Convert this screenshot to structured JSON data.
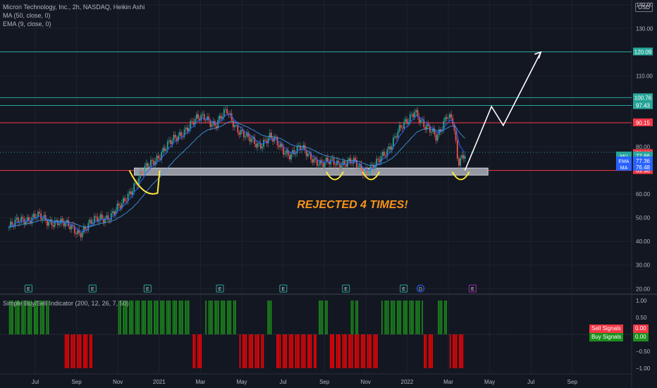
{
  "header": {
    "title": "Micron Technology, Inc., 2h, NASDAQ, Heikin Ashi",
    "ma_legend": "MA (50, close, 0)",
    "ema_legend": "EMA (9, close, 0)",
    "currency": "USD"
  },
  "indicator": {
    "legend": "Simple Buy/Sell Indicator (200, 12, 26, 7, 50)",
    "sell_label": "Sell Signals",
    "sell_value": "0.00",
    "buy_label": "Buy Signals",
    "buy_value": "0.00",
    "y_ticks": [
      "1.00",
      "0.50",
      "0.00",
      "−0.50",
      "−1.00"
    ]
  },
  "annotation": {
    "text": "REJECTED 4 TIMES!"
  },
  "colors": {
    "background": "#131722",
    "up_candle": "#26a69a",
    "down_candle": "#ef5350",
    "resistance_green": "#26a69a",
    "resistance_red": "#f23645",
    "annotation_orange": "#f7931a",
    "circle_yellow": "#ffeb3b",
    "ema_blue": "#2962ff",
    "buy_green": "#1b8f1b",
    "sell_red": "#ff0000"
  },
  "chart_data": {
    "type": "candlestick",
    "symbol": "MU",
    "x_ticks": [
      "Jul",
      "Sep",
      "Nov",
      "2021",
      "Mar",
      "May",
      "Jul",
      "Sep",
      "Nov",
      "2022",
      "Mar",
      "May",
      "Jul",
      "Sep"
    ],
    "y_ticks": [
      20.0,
      30.0,
      40.0,
      50.0,
      60.0,
      70.0,
      80.0,
      90.0,
      100.0,
      110.0,
      120.0,
      130.0,
      140.0
    ],
    "ylim": [
      18,
      142
    ],
    "horizontal_levels": [
      {
        "value": 120.09,
        "label": "120.09",
        "color": "#26a69a"
      },
      {
        "value": 100.76,
        "label": "100.76",
        "color": "#26a69a"
      },
      {
        "value": 97.43,
        "label": "97.43",
        "color": "#26a69a"
      },
      {
        "value": 90.15,
        "label": "90.15",
        "color": "#f23645"
      },
      {
        "value": 69.98,
        "label": "69.98",
        "color": "#f23645"
      }
    ],
    "price_labels": [
      {
        "name": "78.09",
        "value": 78.09,
        "tag": "",
        "color": "#f23645"
      },
      {
        "name": "MU",
        "value": 77.66,
        "tag": "MU",
        "color": "#26a69a"
      },
      {
        "name": "EMA",
        "value": 77.36,
        "tag": "EMA",
        "color": "#2962ff"
      },
      {
        "name": "MA",
        "value": 76.48,
        "tag": "MA",
        "color": "#2962ff"
      }
    ],
    "support_zone": [
      68.0,
      71.0
    ],
    "projection_path": [
      {
        "x": "2022-03-18",
        "y": 70
      },
      {
        "x": "2022-04-25",
        "y": 97
      },
      {
        "x": "2022-05-12",
        "y": 89
      },
      {
        "x": "2022-07-05",
        "y": 120
      }
    ],
    "close_series": [
      {
        "x": "2020-06-01",
        "y": 46
      },
      {
        "x": "2020-06-20",
        "y": 49
      },
      {
        "x": "2020-07-10",
        "y": 51
      },
      {
        "x": "2020-07-25",
        "y": 48
      },
      {
        "x": "2020-08-10",
        "y": 49
      },
      {
        "x": "2020-08-25",
        "y": 46
      },
      {
        "x": "2020-09-10",
        "y": 44
      },
      {
        "x": "2020-09-25",
        "y": 47
      },
      {
        "x": "2020-10-10",
        "y": 50
      },
      {
        "x": "2020-10-25",
        "y": 51
      },
      {
        "x": "2020-11-10",
        "y": 55
      },
      {
        "x": "2020-11-25",
        "y": 63
      },
      {
        "x": "2020-12-10",
        "y": 69
      },
      {
        "x": "2020-12-25",
        "y": 74
      },
      {
        "x": "2021-01-10",
        "y": 79
      },
      {
        "x": "2021-01-25",
        "y": 83
      },
      {
        "x": "2021-02-10",
        "y": 88
      },
      {
        "x": "2021-02-25",
        "y": 91
      },
      {
        "x": "2021-03-10",
        "y": 93
      },
      {
        "x": "2021-03-25",
        "y": 89
      },
      {
        "x": "2021-04-10",
        "y": 95
      },
      {
        "x": "2021-04-25",
        "y": 88
      },
      {
        "x": "2021-05-10",
        "y": 83
      },
      {
        "x": "2021-05-25",
        "y": 81
      },
      {
        "x": "2021-06-10",
        "y": 84
      },
      {
        "x": "2021-06-25",
        "y": 80
      },
      {
        "x": "2021-07-10",
        "y": 77
      },
      {
        "x": "2021-07-25",
        "y": 79
      },
      {
        "x": "2021-08-10",
        "y": 76
      },
      {
        "x": "2021-08-25",
        "y": 72
      },
      {
        "x": "2021-09-10",
        "y": 74
      },
      {
        "x": "2021-09-25",
        "y": 73
      },
      {
        "x": "2021-10-10",
        "y": 73
      },
      {
        "x": "2021-10-25",
        "y": 70
      },
      {
        "x": "2021-11-10",
        "y": 72
      },
      {
        "x": "2021-11-25",
        "y": 78
      },
      {
        "x": "2021-12-10",
        "y": 86
      },
      {
        "x": "2021-12-25",
        "y": 90
      },
      {
        "x": "2022-01-05",
        "y": 96
      },
      {
        "x": "2022-01-20",
        "y": 88
      },
      {
        "x": "2022-02-05",
        "y": 84
      },
      {
        "x": "2022-02-20",
        "y": 94
      },
      {
        "x": "2022-03-01",
        "y": 90
      },
      {
        "x": "2022-03-08",
        "y": 72
      },
      {
        "x": "2022-03-18",
        "y": 77.66
      }
    ],
    "earnings_markers": [
      {
        "x": "2020-06-29",
        "label": "E"
      },
      {
        "x": "2020-09-29",
        "label": "E"
      },
      {
        "x": "2020-12-17",
        "label": "E"
      },
      {
        "x": "2021-03-31",
        "label": "E"
      },
      {
        "x": "2021-06-30",
        "label": "E"
      },
      {
        "x": "2021-09-28",
        "label": "E"
      },
      {
        "x": "2021-12-20",
        "label": "E"
      },
      {
        "x": "2022-03-29",
        "label": "E"
      }
    ],
    "dividend_markers": [
      {
        "x": "2022-01-03",
        "label": "D"
      }
    ],
    "indicator_signals": {
      "buy_ranges": [
        [
          "2020-06-01",
          "2020-07-28"
        ],
        [
          "2020-11-05",
          "2021-02-15"
        ],
        [
          "2021-03-10",
          "2021-04-22"
        ],
        [
          "2021-06-05",
          "2021-06-12"
        ],
        [
          "2021-08-20",
          "2021-09-01"
        ],
        [
          "2021-10-05",
          "2021-10-15"
        ],
        [
          "2021-11-18",
          "2022-01-15"
        ],
        [
          "2022-02-05",
          "2022-02-20"
        ]
      ],
      "sell_ranges": [
        [
          "2020-08-20",
          "2020-09-28"
        ],
        [
          "2021-02-20",
          "2021-03-05"
        ],
        [
          "2021-04-28",
          "2021-06-02"
        ],
        [
          "2021-06-18",
          "2021-08-15"
        ],
        [
          "2021-09-05",
          "2021-11-12"
        ],
        [
          "2022-01-18",
          "2022-02-02"
        ],
        [
          "2022-02-24",
          "2022-03-18"
        ]
      ]
    }
  }
}
